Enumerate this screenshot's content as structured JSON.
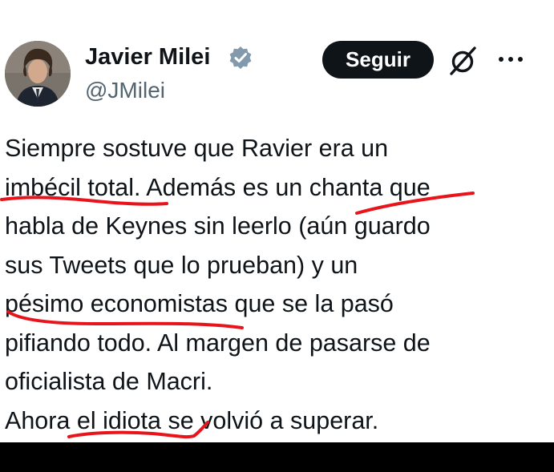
{
  "author": {
    "display_name": "Javier Milei",
    "handle": "@JMilei",
    "verified_badge_icon": "verified-badge-icon",
    "avatar_icon": "profile-photo"
  },
  "actions": {
    "follow_label": "Seguir",
    "grok_icon": "grok-icon",
    "more_icon": "more-dots-icon"
  },
  "tweet": {
    "lines": [
      "Siempre sostuve que Ravier era un",
      "imbécil total. Además es un chanta que",
      "habla de Keynes sin leerlo (aún guardo",
      "sus Tweets que lo prueban) y un",
      "pésimo economistas que se la pasó",
      "pifiando todo. Al margen de pasarse de",
      "oficialista de Macri.",
      "Ahora el idiota se volvió a superar."
    ]
  },
  "colors": {
    "text": "#0f1419",
    "secondary_text": "#536471",
    "follow_button_bg": "#0f1419",
    "verified_badge": "#829aab",
    "annotation_marker": "#e8141b"
  }
}
